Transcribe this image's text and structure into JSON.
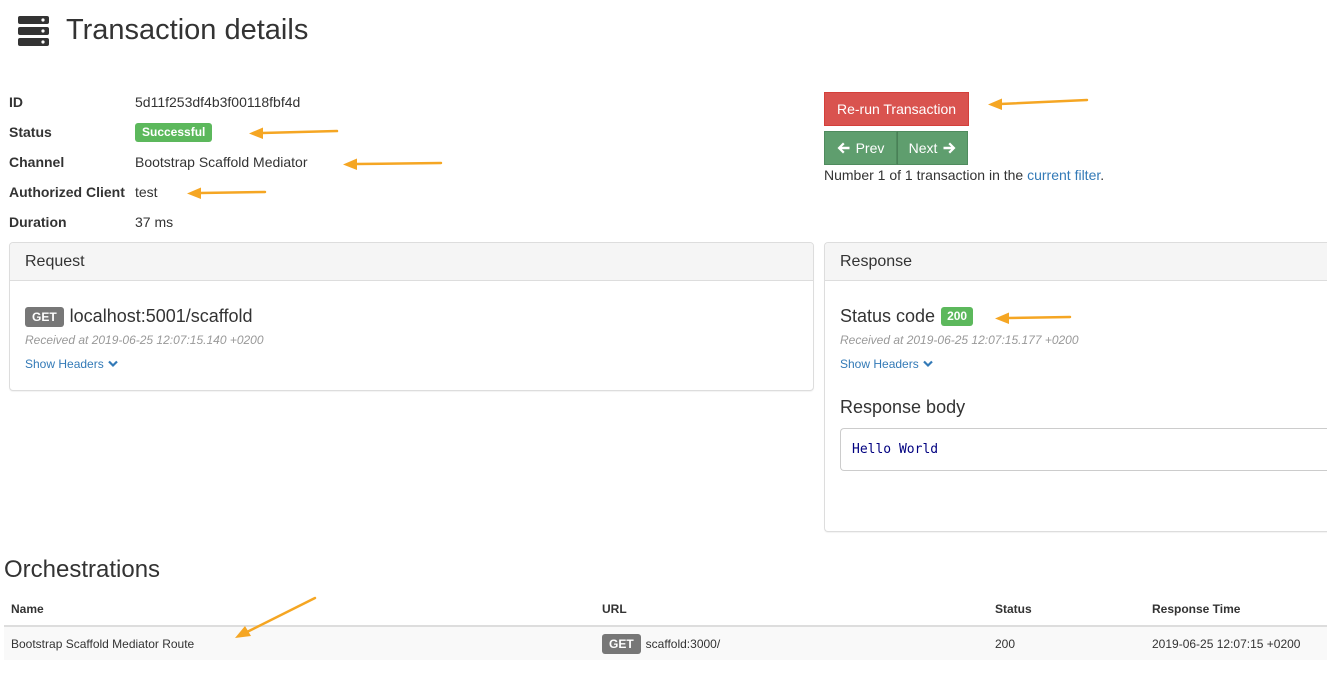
{
  "header": {
    "title": "Transaction details",
    "icon": "server-icon"
  },
  "info": [
    {
      "label": "ID",
      "value": "5d11f253df4b3f00118fbf4d"
    },
    {
      "label": "Status",
      "value": "Successful"
    },
    {
      "label": "Channel",
      "value": "Bootstrap Scaffold Mediator"
    },
    {
      "label": "Authorized Client",
      "value": "test"
    },
    {
      "label": "Duration",
      "value": "37 ms"
    }
  ],
  "actions": {
    "rerun_label": "Re-run Transaction",
    "prev_label": "Prev",
    "next_label": "Next",
    "filter_note_prefix": "Number 1 of 1 transaction in the ",
    "filter_link": "current filter",
    "filter_note_suffix": "."
  },
  "request": {
    "heading": "Request",
    "method": "GET",
    "url": "localhost:5001/scaffold",
    "received": "Received at 2019-06-25 12:07:15.140 +0200",
    "show_headers": "Show Headers"
  },
  "response": {
    "heading": "Response",
    "status_title": "Status code",
    "status_code": "200",
    "received": "Received at 2019-06-25 12:07:15.177 +0200",
    "show_headers": "Show Headers",
    "body_title": "Response body",
    "body": "Hello World"
  },
  "orchestrations": {
    "title": "Orchestrations",
    "columns": [
      "Name",
      "URL",
      "Status",
      "Response Time"
    ],
    "rows": [
      {
        "name": "Bootstrap Scaffold Mediator Route",
        "method": "GET",
        "url": "scaffold:3000/",
        "status": "200",
        "response_time": "2019-06-25 12:07:15 +0200"
      }
    ]
  },
  "colors": {
    "success": "#5cb85c",
    "danger": "#d9534f",
    "nav_button": "#5f9e6e",
    "link": "#337ab7",
    "annotation_arrow": "#f5a623"
  }
}
